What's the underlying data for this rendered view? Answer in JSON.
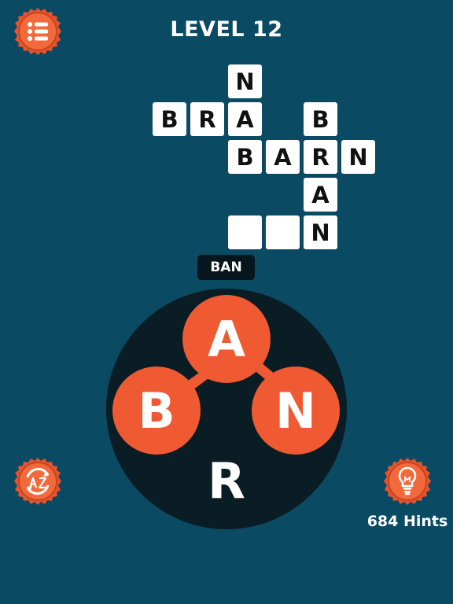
{
  "header": {
    "title": "LEVEL 12"
  },
  "icons": {
    "menu": "list-icon",
    "shuffle": "shuffle-az-icon",
    "hint": "lightbulb-icon"
  },
  "colors": {
    "background": "#0b4a63",
    "accent": "#f05a33",
    "wheel": "#0a1c24",
    "tile": "#ffffff"
  },
  "grid": {
    "row_nab_n": "N",
    "row_nab_a": "A",
    "row_nab_b": "B",
    "row_bra_b": "B",
    "row_bra_r": "R",
    "row_bar_b": "B",
    "row_bar_a": "A",
    "row_bar_r": "R",
    "row_bar_n": "N",
    "row_bran_b": "B",
    "row_bran_a": "A",
    "row_bran_n": "N"
  },
  "preview_word": "BAN",
  "wheel_letters": {
    "top": "A",
    "left": "B",
    "right": "N",
    "bottom": "R"
  },
  "hints": {
    "count_label": "684 Hints"
  }
}
